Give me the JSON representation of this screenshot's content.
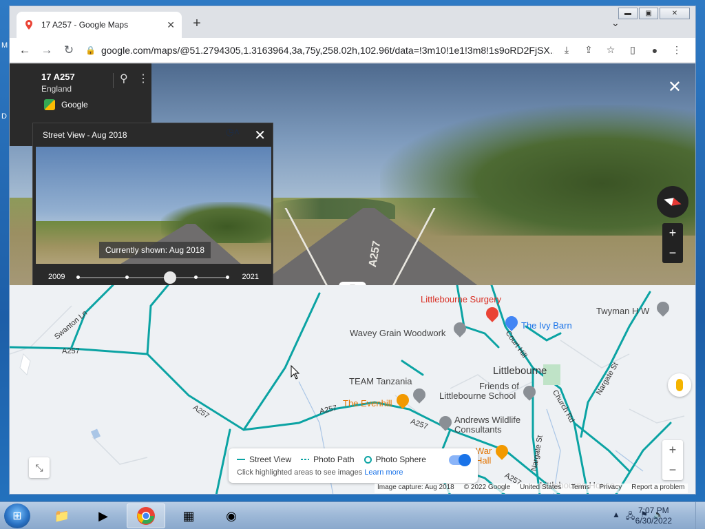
{
  "browser": {
    "tab_title": "17 A257 - Google Maps",
    "url": "google.com/maps/@51.2794305,1.3163964,3a,75y,258.02h,102.96t/data=!3m10!1e1!3m8!1s9oRD2FjSX...",
    "window_controls": [
      "minimize",
      "maximize",
      "close"
    ]
  },
  "streetview": {
    "address_title": "17 A257",
    "address_region": "England",
    "source": "Google",
    "time_panel": {
      "heading": "Street View - Aug 2018",
      "currently_shown": "Currently shown: Aug 2018",
      "year_start": "2009",
      "year_end": "2021",
      "selected_fraction": 0.62
    },
    "road_label": "A257"
  },
  "map": {
    "labels": {
      "surgery": "Littlebourne Surgery",
      "ivy_barn": "The Ivy Barn",
      "twyman": "Twyman H W",
      "wavey": "Wavey Grain Woodwork",
      "littlebourne": "Littlebourne",
      "team_tanzania": "TEAM Tanzania",
      "friends_school": "Friends of",
      "school": "Littlebourne School",
      "evenhill": "The Evenhill",
      "andrews1": "Andrews Wildlife",
      "andrews2": "Consultants",
      "war_hall": "War",
      "hall": "Hall",
      "littlebourne_house": "Littlebourne House",
      "court_hill": "Court Hill",
      "church_rd": "Church Rd",
      "nargate_st": "Nargate St",
      "nargate_st2": "Nargate St",
      "swanton": "Swanton Ln",
      "a257_1": "A257",
      "a257_2": "A257",
      "a257_3": "A257",
      "a257_4": "A257",
      "a257_5": "A257"
    },
    "legend": {
      "street_view": "Street View",
      "photo_path": "Photo Path",
      "photo_sphere": "Photo Sphere",
      "hint": "Click highlighted areas to see images",
      "learn_more": "Learn more"
    },
    "footer": {
      "image_capture": "Image capture: Aug 2018",
      "copyright": "© 2022 Google",
      "country": "United States",
      "terms": "Terms",
      "privacy": "Privacy",
      "report": "Report a problem"
    },
    "zoom_in": "+",
    "zoom_out": "−"
  },
  "taskbar": {
    "time": "7:07 PM",
    "date": "6/30/2022"
  },
  "colors": {
    "streetview_lines": "#0ba3a3",
    "accent": "#1a73e8"
  }
}
